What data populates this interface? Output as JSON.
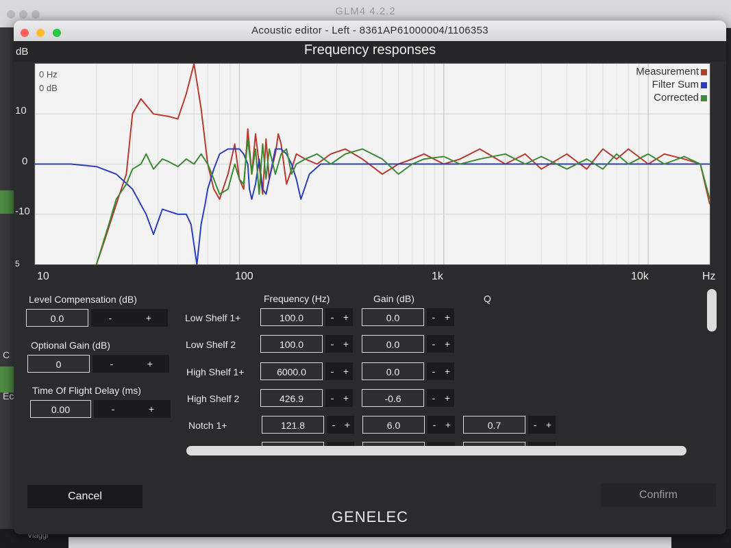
{
  "background_app": {
    "title": "GLM4  4.2.2",
    "left_labels": [
      "C",
      "Ec"
    ],
    "bottom_label": "Viaggi"
  },
  "window": {
    "title": "Acoustic editor - Left - 8361AP61000004/1106353"
  },
  "chart": {
    "title": "Frequency responses",
    "y_unit": "dB",
    "x_unit": "Hz",
    "y_ticks": [
      "10",
      "0",
      "-10",
      "5"
    ],
    "x_ticks": [
      "10",
      "100",
      "1k",
      "10k"
    ],
    "readout": {
      "freq": "0 Hz",
      "gain": "0 dB"
    },
    "legend": [
      {
        "label": "Measurement",
        "color": "#b83a2e"
      },
      {
        "label": "Filter Sum",
        "color": "#2a3fb8"
      },
      {
        "label": "Corrected",
        "color": "#3d8a34"
      }
    ]
  },
  "chart_data": {
    "type": "line",
    "x_scale": "log",
    "xlim": [
      10,
      20000
    ],
    "ylim": [
      -20,
      20
    ],
    "grid": true,
    "legend_position": "top-right",
    "series": [
      {
        "name": "Measurement",
        "color": "#b83a2e",
        "x": [
          20,
          22,
          25,
          28,
          30,
          33,
          38,
          45,
          50,
          55,
          60,
          65,
          70,
          75,
          80,
          88,
          95,
          100,
          105,
          110,
          115,
          120,
          130,
          135,
          140,
          150,
          155,
          160,
          170,
          180,
          190,
          210,
          240,
          280,
          330,
          400,
          500,
          600,
          700,
          800,
          1000,
          1200,
          1500,
          2000,
          2500,
          3000,
          4000,
          5000,
          6000,
          7000,
          8000,
          10000,
          12000,
          15000,
          18000,
          20000
        ],
        "y": [
          -20,
          -15,
          -8,
          -2,
          10,
          13,
          10,
          9.5,
          9,
          14,
          20,
          11,
          0,
          -5,
          -7,
          -2,
          4,
          -3,
          -5,
          7,
          -2,
          6,
          -6,
          5,
          -3,
          2,
          6,
          4,
          -4,
          -1,
          2,
          1,
          0,
          2,
          3,
          1,
          -2,
          0,
          1,
          2,
          0,
          1,
          3,
          0,
          2,
          -1,
          2,
          -1,
          3,
          1,
          3,
          0,
          2,
          1,
          0,
          -8
        ]
      },
      {
        "name": "Filter Sum",
        "color": "#2a3fb8",
        "x": [
          10,
          15,
          20,
          25,
          30,
          35,
          38,
          42,
          50,
          55,
          58,
          62,
          65,
          68,
          70,
          75,
          80,
          88,
          95,
          100,
          105,
          110,
          112,
          115,
          120,
          125,
          130,
          135,
          140,
          150,
          160,
          170,
          180,
          190,
          200,
          220,
          250,
          300,
          500,
          1000,
          2000,
          5000,
          10000,
          20000
        ],
        "y": [
          0,
          0,
          -0.5,
          -2,
          -5,
          -10,
          -14,
          -9,
          -10,
          -10,
          -12,
          -20,
          -12,
          -8,
          -5,
          -1,
          2,
          3,
          3,
          3,
          2,
          0,
          -5,
          -7,
          -4,
          1,
          -5,
          -6,
          -3,
          3,
          3,
          2,
          0,
          -3,
          -7,
          -2,
          0,
          0,
          0,
          0,
          0,
          0,
          0,
          0
        ]
      },
      {
        "name": "Corrected",
        "color": "#3d8a34",
        "x": [
          20,
          23,
          25,
          28,
          30,
          33,
          35,
          38,
          42,
          45,
          50,
          55,
          60,
          65,
          70,
          75,
          80,
          88,
          95,
          100,
          105,
          110,
          115,
          120,
          125,
          130,
          135,
          140,
          150,
          155,
          160,
          170,
          180,
          190,
          210,
          240,
          280,
          330,
          400,
          500,
          600,
          700,
          800,
          1000,
          1200,
          1500,
          2000,
          2500,
          3000,
          4000,
          5000,
          6000,
          7000,
          8000,
          10000,
          12000,
          15000,
          18000,
          20000
        ],
        "y": [
          -20,
          -12,
          -7,
          -4,
          -1,
          0,
          2,
          -1,
          1,
          0.5,
          -0.5,
          1,
          0,
          2,
          0,
          -3,
          -6,
          -5,
          0,
          -3,
          -4,
          5,
          -2,
          3,
          -6,
          4,
          -3,
          3,
          -2,
          0,
          2,
          3,
          -2,
          0,
          1,
          2,
          0,
          2,
          3,
          1,
          -2,
          0,
          1,
          1.5,
          0,
          1,
          2,
          0,
          1.5,
          -1,
          1,
          -1,
          2,
          0,
          2,
          0,
          1.5,
          0,
          -7
        ]
      }
    ]
  },
  "level_compensation": {
    "label": "Level Compensation (dB)",
    "value": "0.0"
  },
  "optional_gain": {
    "label": "Optional Gain (dB)",
    "value": "0"
  },
  "tof_delay": {
    "label": "Time Of Flight Delay (ms)",
    "value": "0.00"
  },
  "stepper": {
    "minus": "-",
    "plus": "+"
  },
  "filters": {
    "headers": {
      "frequency": "Frequency (Hz)",
      "gain": "Gain (dB)",
      "q": "Q"
    },
    "rows": [
      {
        "name": "Low Shelf 1+",
        "frequency": "100.0",
        "gain": "0.0"
      },
      {
        "name": "Low Shelf 2",
        "frequency": "100.0",
        "gain": "0.0"
      },
      {
        "name": "High Shelf 1+",
        "frequency": "6000.0",
        "gain": "0.0"
      },
      {
        "name": "High Shelf 2",
        "frequency": "426.9",
        "gain": "-0.6"
      },
      {
        "name": "Notch 1+",
        "frequency": "121.8",
        "gain": "6.0",
        "q": "0.7"
      }
    ]
  },
  "buttons": {
    "cancel": "Cancel",
    "confirm": "Confirm"
  },
  "brand": "GENELEC"
}
